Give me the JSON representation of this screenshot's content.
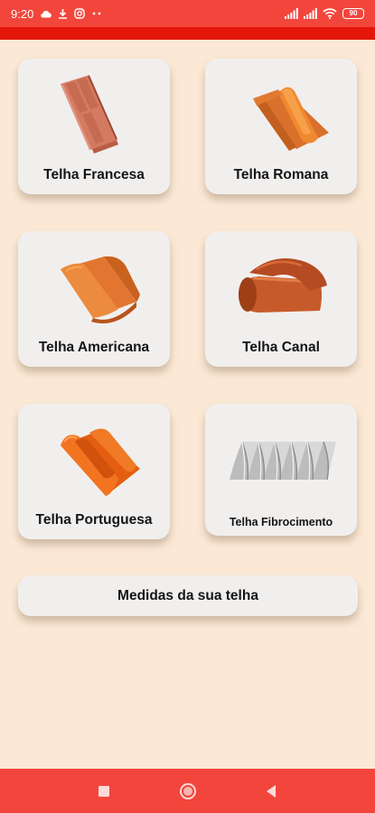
{
  "status_bar": {
    "time": "9:20",
    "battery": "90",
    "left_icons": [
      "cloud-icon",
      "download-icon",
      "instagram-icon",
      "more-dots-icon"
    ],
    "right_icons": [
      "signal-icon",
      "signal-icon",
      "wifi-icon",
      "battery-icon"
    ]
  },
  "colors": {
    "status_bar": "#f2463c",
    "app_bar": "#e4150a",
    "background": "#fbe9d6",
    "card": "#f1efee",
    "terracotta": "#e27631",
    "nav_bar": "#f2463c"
  },
  "tiles": [
    {
      "label": "Telha Francesa",
      "icon": "telha-francesa-image"
    },
    {
      "label": "Telha Romana",
      "icon": "telha-romana-image"
    },
    {
      "label": "Telha Americana",
      "icon": "telha-americana-image"
    },
    {
      "label": "Telha Canal",
      "icon": "telha-canal-image"
    },
    {
      "label": "Telha Portuguesa",
      "icon": "telha-portuguesa-image"
    },
    {
      "label": "Telha Fibrocimento",
      "icon": "telha-fibrocimento-image"
    }
  ],
  "measure_button": {
    "label": "Medidas da sua telha"
  },
  "nav": {
    "icons": [
      "recents-square-icon",
      "home-circle-icon",
      "back-triangle-icon"
    ]
  }
}
